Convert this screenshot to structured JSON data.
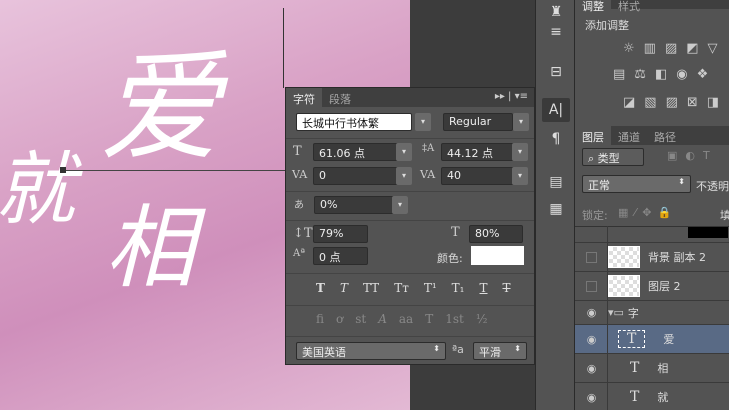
{
  "canvas": {
    "chars": [
      "爱",
      "相",
      "就"
    ]
  },
  "character_panel": {
    "tabs": [
      "字符",
      "段落"
    ],
    "font_family": "长城中行书体繁",
    "font_style": "Regular",
    "font_size": "61.06 点",
    "leading": "44.12 点",
    "kerning": "0",
    "tracking": "40",
    "tsume": "0%",
    "vertical_scale": "79%",
    "horizontal_scale": "80%",
    "baseline_shift": "0 点",
    "color_label": "颜色:",
    "color": "#ffffff",
    "style_buttons": [
      "T",
      "T",
      "TT",
      "Tт",
      "T¹",
      "T₁",
      "T",
      "T"
    ],
    "opentype_buttons": [
      "fi",
      "ơ",
      "st",
      "A",
      "aa",
      "T",
      "1st",
      "½"
    ],
    "language": "美国英语",
    "aa_label": "ªa",
    "antialias": "平滑"
  },
  "adjustments": {
    "tabs": [
      "调整",
      "样式"
    ],
    "title": "添加调整"
  },
  "layers_panel": {
    "tabs": [
      "图层",
      "通道",
      "路径"
    ],
    "filter": "类型",
    "blend_mode": "正常",
    "opacity_label": "不透明",
    "lock_label": "锁定:",
    "fill_label": "填",
    "layers": [
      {
        "name": "背景 副本 2",
        "visible": false,
        "type": "pixel"
      },
      {
        "name": "图层 2",
        "visible": false,
        "type": "pixel"
      },
      {
        "name": "字",
        "visible": true,
        "type": "group"
      },
      {
        "name": "爱",
        "visible": true,
        "type": "text",
        "selected": true
      },
      {
        "name": "相",
        "visible": true,
        "type": "text"
      },
      {
        "name": "就",
        "visible": true,
        "type": "text"
      }
    ]
  }
}
